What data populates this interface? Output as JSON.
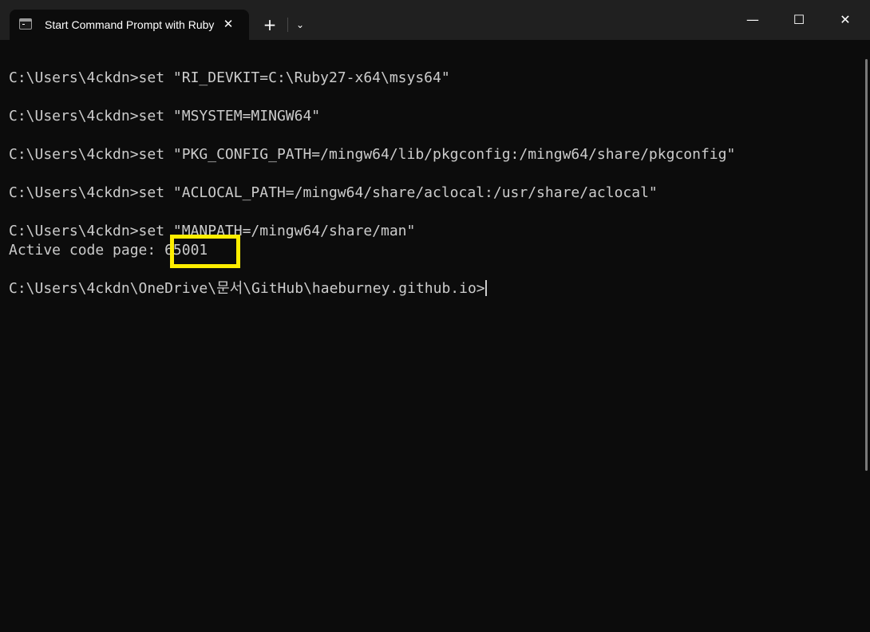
{
  "window": {
    "tab_title": "Start Command Prompt with Ruby",
    "tab_icon": "console-icon",
    "close_tab_glyph": "✕",
    "new_tab_glyph": "+",
    "dropdown_glyph": "⌄",
    "minimize_glyph": "—",
    "maximize_glyph": "☐",
    "close_glyph": "✕"
  },
  "terminal": {
    "lines": [
      "C:\\Users\\4ckdn>set \"RI_DEVKIT=C:\\Ruby27-x64\\msys64\"",
      "C:\\Users\\4ckdn>set \"MSYSTEM=MINGW64\"",
      "C:\\Users\\4ckdn>set \"PKG_CONFIG_PATH=/mingw64/lib/pkgconfig:/mingw64/share/pkgconfig\"",
      "C:\\Users\\4ckdn>set \"ACLOCAL_PATH=/mingw64/share/aclocal:/usr/share/aclocal\"",
      "C:\\Users\\4ckdn>set \"MANPATH=/mingw64/share/man\"",
      "Active code page: 65001",
      "C:\\Users\\4ckdn\\OneDrive\\문서\\GitHub\\haeburney.github.io>"
    ]
  },
  "colors": {
    "background": "#0c0c0c",
    "titlebar": "#202020",
    "text": "#cccccc",
    "highlight": "#ffee00"
  }
}
